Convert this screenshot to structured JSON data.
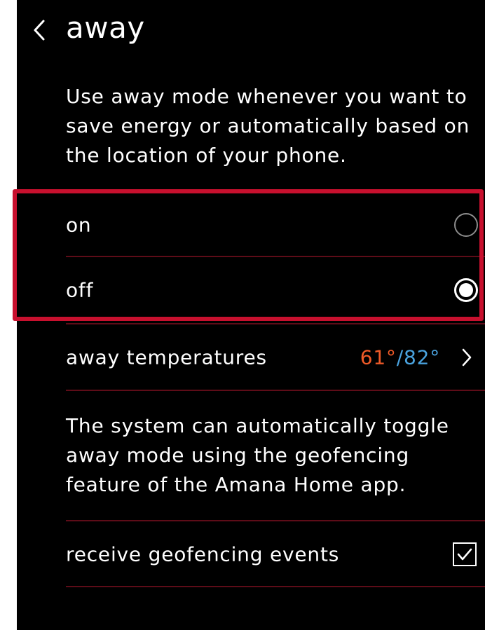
{
  "header": {
    "title": "away",
    "back_icon": "chevron-left-icon"
  },
  "description": "Use away mode whenever you want to\nsave energy or automatically based on\nthe location of your phone.",
  "mode_options": [
    {
      "label": "on",
      "selected": false
    },
    {
      "label": "off",
      "selected": true
    }
  ],
  "away_temperatures": {
    "label": "away temperatures",
    "heat": "61°",
    "separator": "/",
    "cool": "82°",
    "heat_color": "#f05a28",
    "cool_color": "#4aa3df"
  },
  "geofencing_description": "The system can automatically toggle\naway mode using the geofencing\nfeature of the Amana Home app.",
  "geofencing": {
    "label": "receive geofencing events",
    "checked": true
  },
  "colors": {
    "background": "#000000",
    "divider": "#5e0c18",
    "highlight": "#c8102e"
  }
}
